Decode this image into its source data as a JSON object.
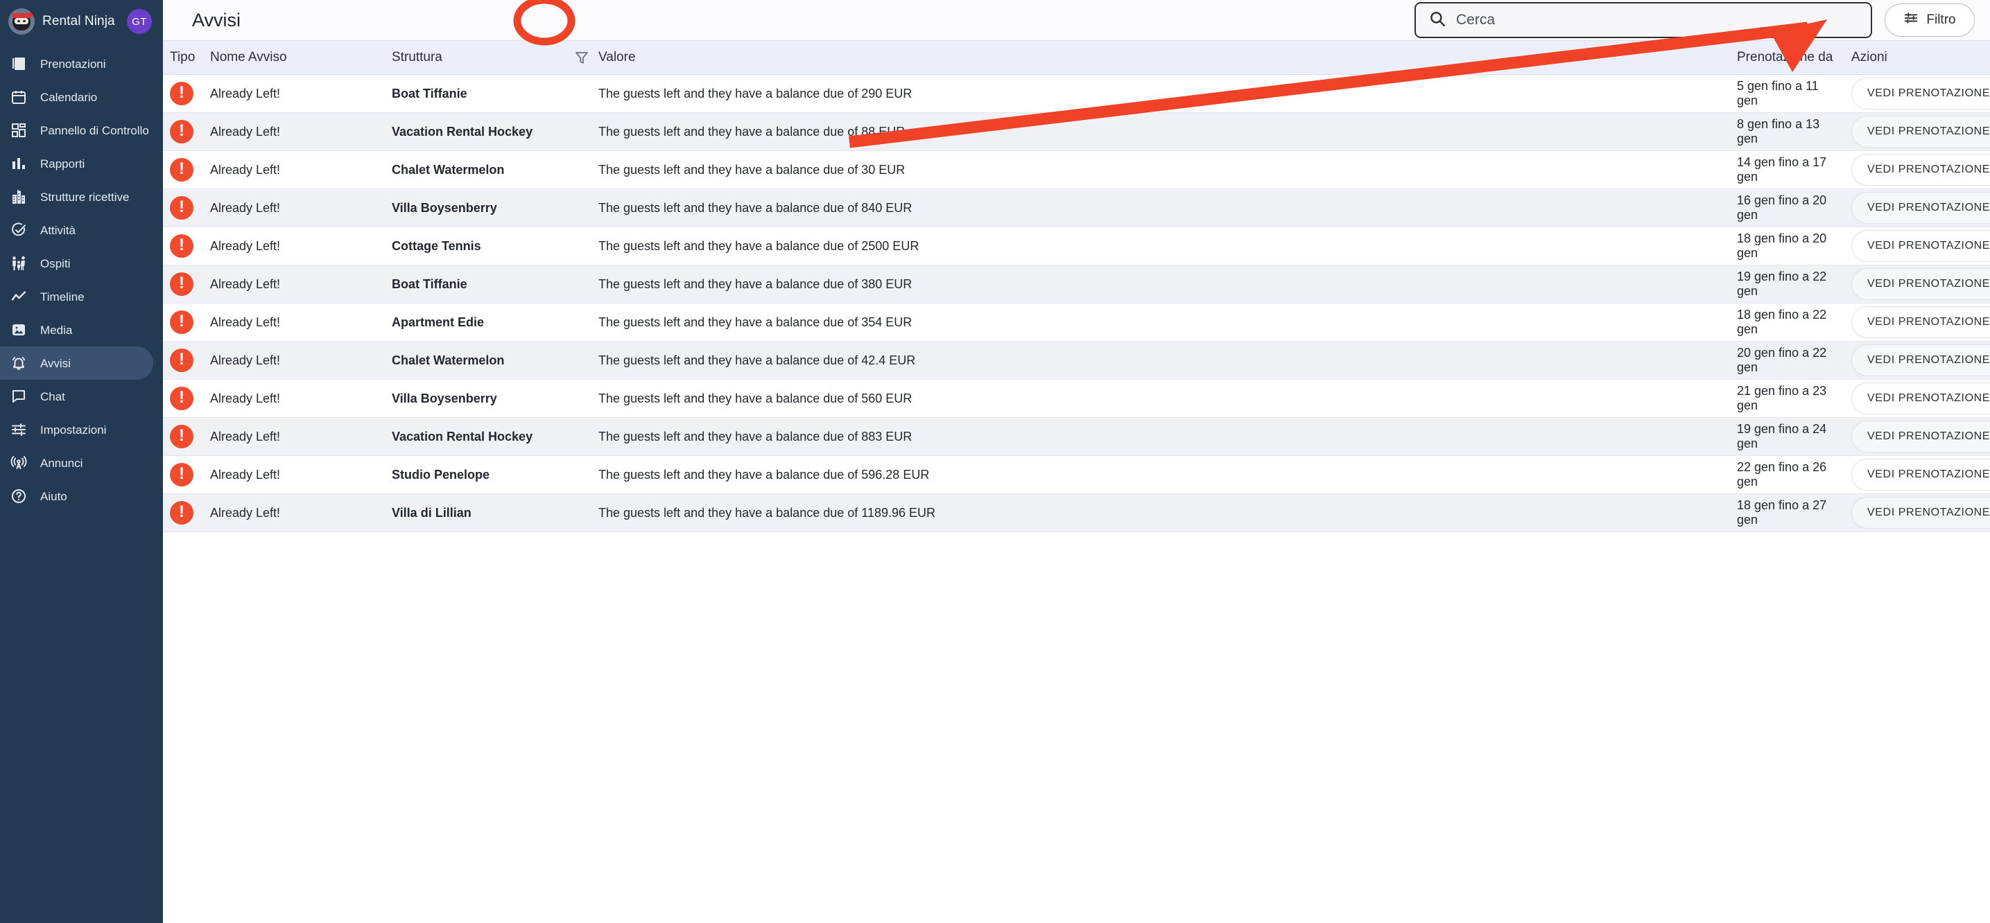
{
  "sidebar": {
    "brand": {
      "name": "Rental Ninja",
      "logo_icon": "ninja-logo-icon"
    },
    "avatar": {
      "initials": "GT",
      "color": "#6b3fc9"
    },
    "items": [
      {
        "label": "Prenotazioni",
        "icon": "bookings-icon",
        "active": false
      },
      {
        "label": "Calendario",
        "icon": "calendar-icon",
        "active": false
      },
      {
        "label": "Pannello di Controllo",
        "icon": "dashboard-icon",
        "active": false
      },
      {
        "label": "Rapporti",
        "icon": "reports-icon",
        "active": false
      },
      {
        "label": "Strutture ricettive",
        "icon": "building-icon",
        "active": false
      },
      {
        "label": "Attività",
        "icon": "task-check-icon",
        "active": false
      },
      {
        "label": "Ospiti",
        "icon": "guests-icon",
        "active": false
      },
      {
        "label": "Timeline",
        "icon": "timeline-icon",
        "active": false
      },
      {
        "label": "Media",
        "icon": "media-image-icon",
        "active": false
      },
      {
        "label": "Avvisi",
        "icon": "bell-alert-icon",
        "active": true
      },
      {
        "label": "Chat",
        "icon": "chat-icon",
        "active": false
      },
      {
        "label": "Impostazioni",
        "icon": "settings-sliders-icon",
        "active": false
      },
      {
        "label": "Annunci",
        "icon": "broadcast-icon",
        "active": false
      },
      {
        "label": "Aiuto",
        "icon": "help-circle-icon",
        "active": false
      }
    ]
  },
  "header": {
    "title": "Avvisi",
    "search": {
      "placeholder": "Cerca",
      "value": "",
      "icon": "search-icon"
    },
    "filter_button": {
      "label": "Filtro",
      "icon": "filter-sliders-icon"
    }
  },
  "table": {
    "columns": [
      "Tipo",
      "Nome Avviso",
      "Struttura",
      "Valore",
      "Prenotazione da",
      "Azioni"
    ],
    "column_filter_icon": "funnel-filter-icon",
    "action_label": "VEDI PRENOTAZIONE",
    "alert_icon": "alert-exclamation-icon",
    "rows": [
      {
        "tipo": "!",
        "nome": "Already Left!",
        "struttura": "Boat Tiffanie",
        "valore": "The guests left and they have a balance due of 290 EUR",
        "data": "5 gen fino a 11 gen"
      },
      {
        "tipo": "!",
        "nome": "Already Left!",
        "struttura": "Vacation Rental Hockey",
        "valore": "The guests left and they have a balance due of 88 EUR",
        "data": "8 gen fino a 13 gen"
      },
      {
        "tipo": "!",
        "nome": "Already Left!",
        "struttura": "Chalet Watermelon",
        "valore": "The guests left and they have a balance due of 30 EUR",
        "data": "14 gen fino a 17 gen"
      },
      {
        "tipo": "!",
        "nome": "Already Left!",
        "struttura": "Villa Boysenberry",
        "valore": "The guests left and they have a balance due of 840 EUR",
        "data": "16 gen fino a 20 gen"
      },
      {
        "tipo": "!",
        "nome": "Already Left!",
        "struttura": "Cottage Tennis",
        "valore": "The guests left and they have a balance due of 2500 EUR",
        "data": "18 gen fino a 20 gen"
      },
      {
        "tipo": "!",
        "nome": "Already Left!",
        "struttura": "Boat Tiffanie",
        "valore": "The guests left and they have a balance due of 380 EUR",
        "data": "19 gen fino a 22 gen"
      },
      {
        "tipo": "!",
        "nome": "Already Left!",
        "struttura": "Apartment Edie",
        "valore": "The guests left and they have a balance due of 354 EUR",
        "data": "18 gen fino a 22 gen"
      },
      {
        "tipo": "!",
        "nome": "Already Left!",
        "struttura": "Chalet Watermelon",
        "valore": "The guests left and they have a balance due of 42.4 EUR",
        "data": "20 gen fino a 22 gen"
      },
      {
        "tipo": "!",
        "nome": "Already Left!",
        "struttura": "Villa Boysenberry",
        "valore": "The guests left and they have a balance due of 560 EUR",
        "data": "21 gen fino a 23 gen"
      },
      {
        "tipo": "!",
        "nome": "Already Left!",
        "struttura": "Vacation Rental Hockey",
        "valore": "The guests left and they have a balance due of 883 EUR",
        "data": "19 gen fino a 24 gen"
      },
      {
        "tipo": "!",
        "nome": "Already Left!",
        "struttura": "Studio Penelope",
        "valore": "The guests left and they have a balance due of 596.28 EUR",
        "data": "22 gen fino a 26 gen"
      },
      {
        "tipo": "!",
        "nome": "Already Left!",
        "struttura": "Villa di Lillian",
        "valore": "The guests left and they have a balance due of 1189.96 EUR",
        "data": "18 gen fino a 27 gen"
      }
    ]
  },
  "annotations": {
    "arrow_color": "#ef4226",
    "ellipse_color": "#ef4226"
  }
}
